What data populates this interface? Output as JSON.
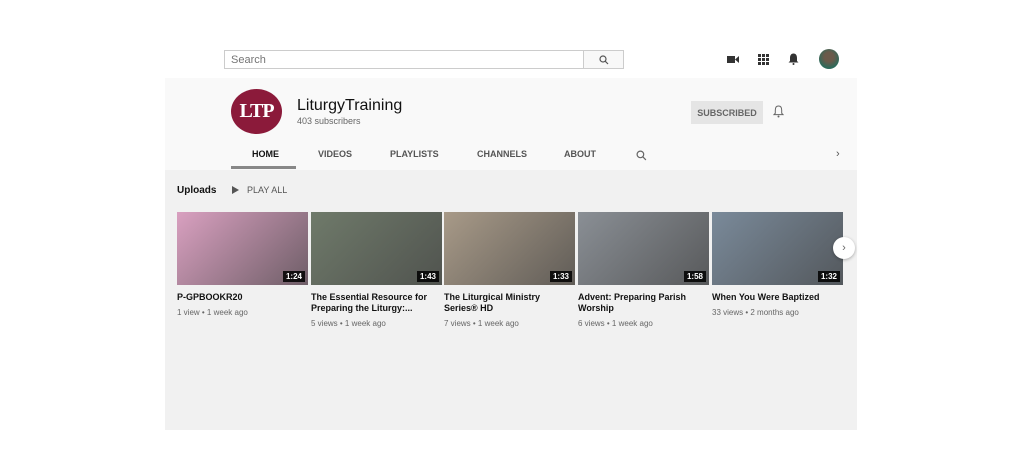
{
  "topbar": {
    "search_placeholder": "Search",
    "icons": [
      "video-camera-icon",
      "apps-grid-icon",
      "bell-icon",
      "avatar"
    ]
  },
  "channel": {
    "logo_text": "LTP",
    "name": "LiturgyTraining",
    "subscribers": "403 subscribers",
    "subscribe_label": "SUBSCRIBED"
  },
  "tabs": [
    {
      "label": "HOME"
    },
    {
      "label": "VIDEOS"
    },
    {
      "label": "PLAYLISTS"
    },
    {
      "label": "CHANNELS"
    },
    {
      "label": "ABOUT"
    }
  ],
  "section": {
    "title": "Uploads",
    "play_all": "PLAY ALL"
  },
  "videos": [
    {
      "title": "P-GPBOOKR20",
      "meta": "1 view • 1 week ago",
      "duration": "1:24",
      "color": "#d9a0c0"
    },
    {
      "title": "The Essential Resource for Preparing the Liturgy:...",
      "meta": "5 views • 1 week ago",
      "duration": "1:43",
      "color": "#6f7a6a"
    },
    {
      "title": "The Liturgical Ministry Series® HD",
      "meta": "7 views • 1 week ago",
      "duration": "1:33",
      "color": "#a89a88"
    },
    {
      "title": "Advent: Preparing Parish Worship",
      "meta": "6 views • 1 week ago",
      "duration": "1:58",
      "color": "#8a8f95"
    },
    {
      "title": "When You Were Baptized",
      "meta": "33 views • 2 months ago",
      "duration": "1:32",
      "color": "#7a8a9a"
    }
  ]
}
